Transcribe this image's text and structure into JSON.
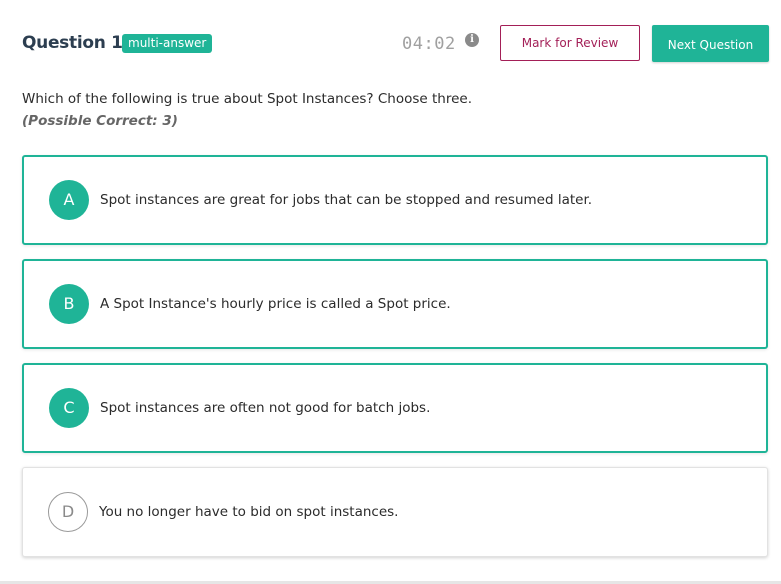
{
  "header": {
    "question_label": "Question 1",
    "type_badge": "multi-answer",
    "timer": "04:02",
    "info_glyph": "i",
    "mark_for_review_label": "Mark for Review",
    "next_question_label": "Next Question"
  },
  "question": {
    "text": "Which of the following is true about Spot Instances? Choose three.",
    "possible_correct": "(Possible Correct: 3)"
  },
  "options": [
    {
      "letter": "A",
      "text": "Spot instances are great for jobs that can be stopped and resumed later.",
      "selected": true
    },
    {
      "letter": "B",
      "text": "A Spot Instance's hourly price is called a Spot price.",
      "selected": true
    },
    {
      "letter": "C",
      "text": "Spot instances are often not good for batch jobs.",
      "selected": true
    },
    {
      "letter": "D",
      "text": "You no longer have to bid on spot instances.",
      "selected": false
    }
  ],
  "colors": {
    "accent": "#1fb497",
    "review": "#a31f57",
    "title": "#2c3e50"
  },
  "icons": {
    "info": "info-icon"
  }
}
